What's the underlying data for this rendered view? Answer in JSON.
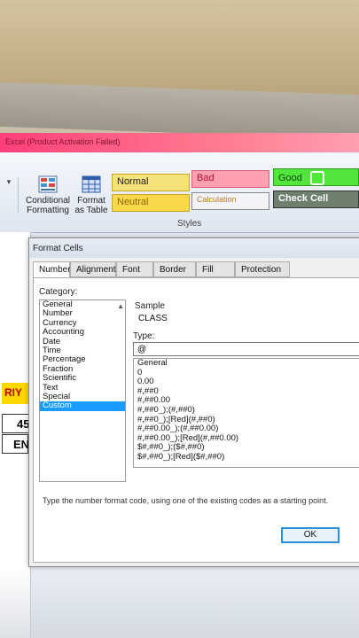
{
  "window": {
    "title": "Excel (Product Activation Failed)"
  },
  "ribbon": {
    "conditional_formatting": "Conditional Formatting",
    "format_as_table": "Format as Table",
    "styles_group_label": "Styles",
    "styles": {
      "normal": "Normal",
      "bad": "Bad",
      "good": "Good",
      "neutral": "Neutral",
      "calculation": "Calculation",
      "check_cell": "Check Cell"
    },
    "colors": {
      "normal_bg": "#f4e17a",
      "bad_bg": "#ff9fb0",
      "good_bg": "#52e63c",
      "neutral_bg": "#f9d84a",
      "check_bg": "#6e7f6e"
    }
  },
  "sheet": {
    "cell_riya": "RIY",
    "cell_45": "45",
    "cell_en": "EN"
  },
  "dialog": {
    "title": "Format Cells",
    "tabs": [
      "Number",
      "Alignment",
      "Font",
      "Border",
      "Fill",
      "Protection"
    ],
    "category_label": "Category:",
    "categories": [
      "General",
      "Number",
      "Currency",
      "Accounting",
      "Date",
      "Time",
      "Percentage",
      "Fraction",
      "Scientific",
      "Text",
      "Special",
      "Custom"
    ],
    "selected_category": "Custom",
    "sample_label": "Sample",
    "sample_value": "CLASS",
    "type_label": "Type:",
    "type_value": "@",
    "codes": [
      "General",
      "0",
      "0.00",
      "#,##0",
      "#,##0.00",
      "#,##0_);(#,##0)",
      "#,##0_);[Red](#,##0)",
      "#,##0.00_);(#,##0.00)",
      "#,##0.00_);[Red](#,##0.00)",
      "$#,##0_);($#,##0)",
      "$#,##0_);[Red]($#,##0)"
    ],
    "hint": "Type the number format code, using one of the existing codes as a starting point.",
    "ok_label": "OK"
  }
}
